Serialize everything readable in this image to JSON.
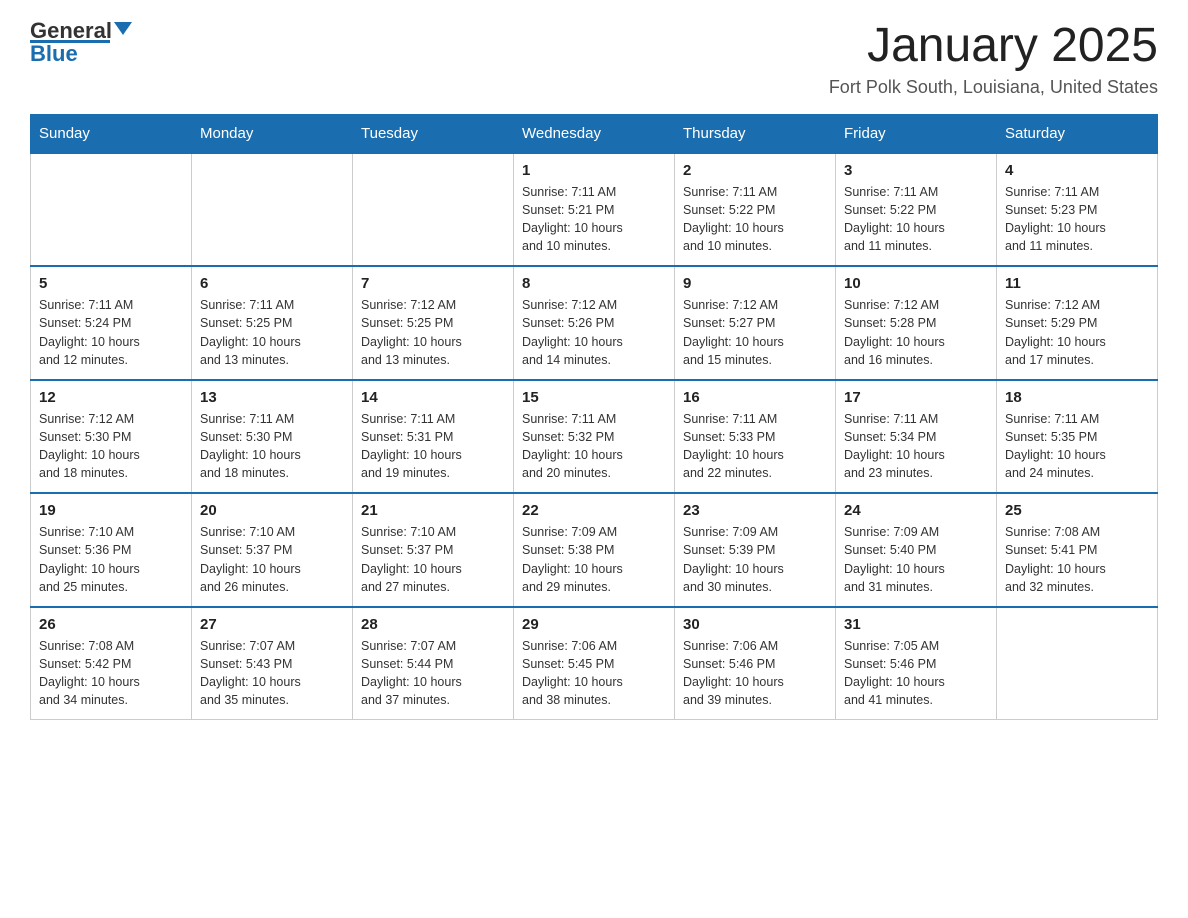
{
  "logo": {
    "text_black": "General",
    "text_blue": "Blue"
  },
  "title": "January 2025",
  "subtitle": "Fort Polk South, Louisiana, United States",
  "days_of_week": [
    "Sunday",
    "Monday",
    "Tuesday",
    "Wednesday",
    "Thursday",
    "Friday",
    "Saturday"
  ],
  "weeks": [
    [
      {
        "day": "",
        "info": ""
      },
      {
        "day": "",
        "info": ""
      },
      {
        "day": "",
        "info": ""
      },
      {
        "day": "1",
        "info": "Sunrise: 7:11 AM\nSunset: 5:21 PM\nDaylight: 10 hours\nand 10 minutes."
      },
      {
        "day": "2",
        "info": "Sunrise: 7:11 AM\nSunset: 5:22 PM\nDaylight: 10 hours\nand 10 minutes."
      },
      {
        "day": "3",
        "info": "Sunrise: 7:11 AM\nSunset: 5:22 PM\nDaylight: 10 hours\nand 11 minutes."
      },
      {
        "day": "4",
        "info": "Sunrise: 7:11 AM\nSunset: 5:23 PM\nDaylight: 10 hours\nand 11 minutes."
      }
    ],
    [
      {
        "day": "5",
        "info": "Sunrise: 7:11 AM\nSunset: 5:24 PM\nDaylight: 10 hours\nand 12 minutes."
      },
      {
        "day": "6",
        "info": "Sunrise: 7:11 AM\nSunset: 5:25 PM\nDaylight: 10 hours\nand 13 minutes."
      },
      {
        "day": "7",
        "info": "Sunrise: 7:12 AM\nSunset: 5:25 PM\nDaylight: 10 hours\nand 13 minutes."
      },
      {
        "day": "8",
        "info": "Sunrise: 7:12 AM\nSunset: 5:26 PM\nDaylight: 10 hours\nand 14 minutes."
      },
      {
        "day": "9",
        "info": "Sunrise: 7:12 AM\nSunset: 5:27 PM\nDaylight: 10 hours\nand 15 minutes."
      },
      {
        "day": "10",
        "info": "Sunrise: 7:12 AM\nSunset: 5:28 PM\nDaylight: 10 hours\nand 16 minutes."
      },
      {
        "day": "11",
        "info": "Sunrise: 7:12 AM\nSunset: 5:29 PM\nDaylight: 10 hours\nand 17 minutes."
      }
    ],
    [
      {
        "day": "12",
        "info": "Sunrise: 7:12 AM\nSunset: 5:30 PM\nDaylight: 10 hours\nand 18 minutes."
      },
      {
        "day": "13",
        "info": "Sunrise: 7:11 AM\nSunset: 5:30 PM\nDaylight: 10 hours\nand 18 minutes."
      },
      {
        "day": "14",
        "info": "Sunrise: 7:11 AM\nSunset: 5:31 PM\nDaylight: 10 hours\nand 19 minutes."
      },
      {
        "day": "15",
        "info": "Sunrise: 7:11 AM\nSunset: 5:32 PM\nDaylight: 10 hours\nand 20 minutes."
      },
      {
        "day": "16",
        "info": "Sunrise: 7:11 AM\nSunset: 5:33 PM\nDaylight: 10 hours\nand 22 minutes."
      },
      {
        "day": "17",
        "info": "Sunrise: 7:11 AM\nSunset: 5:34 PM\nDaylight: 10 hours\nand 23 minutes."
      },
      {
        "day": "18",
        "info": "Sunrise: 7:11 AM\nSunset: 5:35 PM\nDaylight: 10 hours\nand 24 minutes."
      }
    ],
    [
      {
        "day": "19",
        "info": "Sunrise: 7:10 AM\nSunset: 5:36 PM\nDaylight: 10 hours\nand 25 minutes."
      },
      {
        "day": "20",
        "info": "Sunrise: 7:10 AM\nSunset: 5:37 PM\nDaylight: 10 hours\nand 26 minutes."
      },
      {
        "day": "21",
        "info": "Sunrise: 7:10 AM\nSunset: 5:37 PM\nDaylight: 10 hours\nand 27 minutes."
      },
      {
        "day": "22",
        "info": "Sunrise: 7:09 AM\nSunset: 5:38 PM\nDaylight: 10 hours\nand 29 minutes."
      },
      {
        "day": "23",
        "info": "Sunrise: 7:09 AM\nSunset: 5:39 PM\nDaylight: 10 hours\nand 30 minutes."
      },
      {
        "day": "24",
        "info": "Sunrise: 7:09 AM\nSunset: 5:40 PM\nDaylight: 10 hours\nand 31 minutes."
      },
      {
        "day": "25",
        "info": "Sunrise: 7:08 AM\nSunset: 5:41 PM\nDaylight: 10 hours\nand 32 minutes."
      }
    ],
    [
      {
        "day": "26",
        "info": "Sunrise: 7:08 AM\nSunset: 5:42 PM\nDaylight: 10 hours\nand 34 minutes."
      },
      {
        "day": "27",
        "info": "Sunrise: 7:07 AM\nSunset: 5:43 PM\nDaylight: 10 hours\nand 35 minutes."
      },
      {
        "day": "28",
        "info": "Sunrise: 7:07 AM\nSunset: 5:44 PM\nDaylight: 10 hours\nand 37 minutes."
      },
      {
        "day": "29",
        "info": "Sunrise: 7:06 AM\nSunset: 5:45 PM\nDaylight: 10 hours\nand 38 minutes."
      },
      {
        "day": "30",
        "info": "Sunrise: 7:06 AM\nSunset: 5:46 PM\nDaylight: 10 hours\nand 39 minutes."
      },
      {
        "day": "31",
        "info": "Sunrise: 7:05 AM\nSunset: 5:46 PM\nDaylight: 10 hours\nand 41 minutes."
      },
      {
        "day": "",
        "info": ""
      }
    ]
  ]
}
